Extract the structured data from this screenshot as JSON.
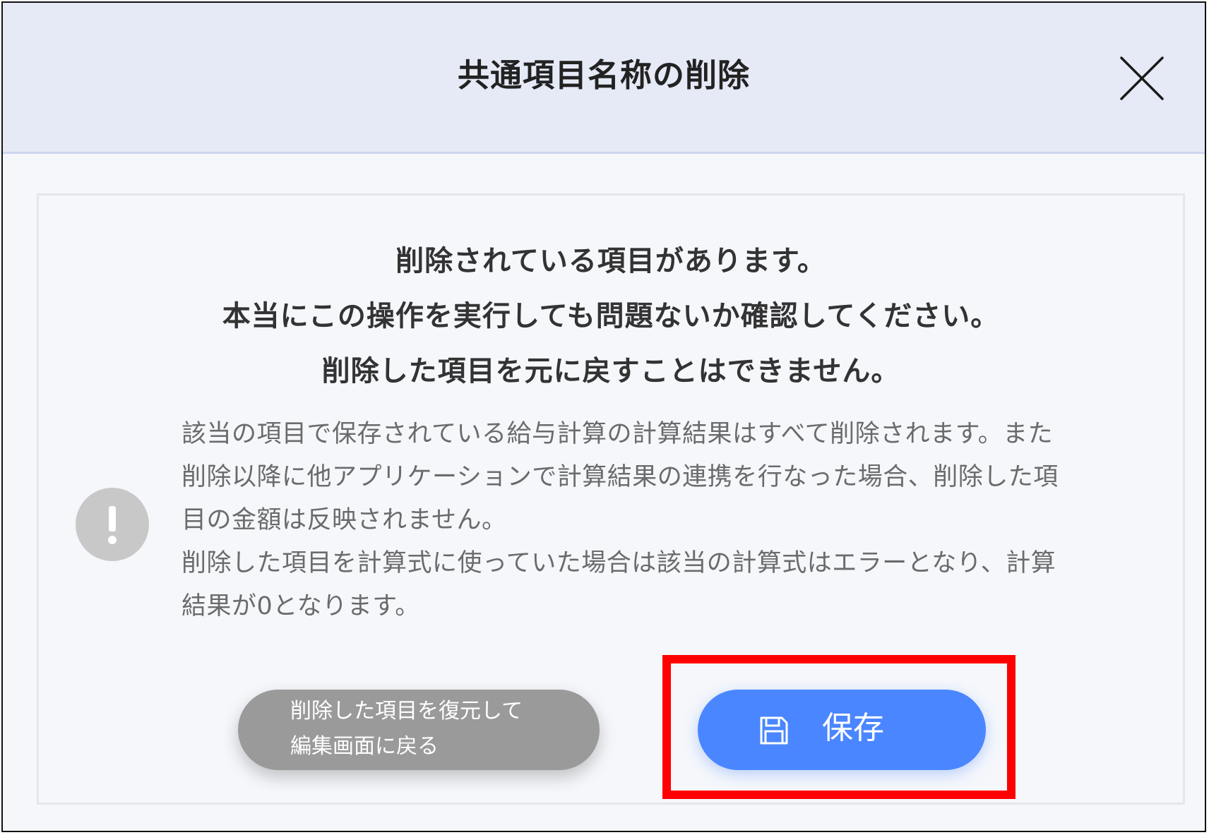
{
  "dialog": {
    "title": "共通項目名称の削除"
  },
  "message": {
    "headline": [
      "削除されている項目があります。",
      "本当にこの操作を実行しても問題ないか確認してください。",
      "削除した項目を元に戻すことはできません。"
    ],
    "details": [
      "該当の項目で保存されている給与計算の計算結果はすべて削除されます。また",
      "削除以降に他アプリケーションで計算結果の連携を行なった場合、削除した項",
      "目の金額は反映されません。",
      "削除した項目を計算式に使っていた場合は該当の計算式はエラーとなり、計算",
      "結果が0となります。"
    ]
  },
  "buttons": {
    "restore_label_lines": [
      "削除した項目を復元して",
      "編集画面に戻る"
    ],
    "save_label": "保存"
  },
  "icons": {
    "close": "close-icon",
    "alert": "exclamation-icon",
    "save": "floppy-disk-icon"
  },
  "colors": {
    "header_bg": "#e6eaf7",
    "body_bg": "#f5f7fb",
    "save_button": "#4a86ff",
    "restore_button": "#9a9a9a",
    "highlight": "#ff0000"
  }
}
